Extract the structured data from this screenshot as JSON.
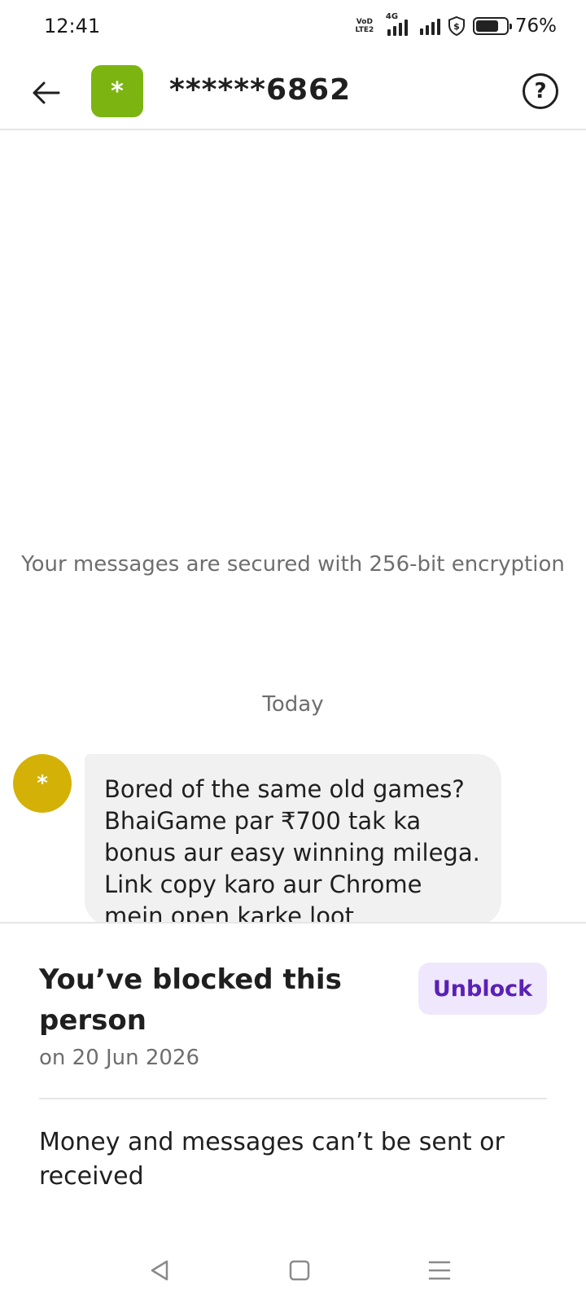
{
  "status_bar": {
    "time": "12:41",
    "volte_label": "VoD LTE2",
    "network_label": "4G",
    "battery_percent": "76%",
    "battery_level": 0.76
  },
  "header": {
    "avatar_initial": "*",
    "avatar_color": "#7cb512",
    "contact_name": "******6862",
    "help_label": "?"
  },
  "chat": {
    "encryption_note": "Your messages are secured with 256-bit encryption",
    "date_separator": "Today",
    "messages": [
      {
        "avatar_initial": "*",
        "avatar_color": "#d4b106",
        "text": "Bored of the same old games? BhaiGame par ₹700 tak ka bonus aur easy winning milega. Link copy karo aur Chrome mein open karke loot"
      }
    ]
  },
  "blocked": {
    "title": "You’ve blocked this person",
    "date": "on 20 Jun 2026",
    "unblock_label": "Unblock",
    "info": "Money and messages can’t be sent or received",
    "accent_color": "#5b21b6"
  },
  "nav_bar": {
    "icons": [
      "back-triangle-icon",
      "home-square-icon",
      "recents-menu-icon"
    ]
  }
}
